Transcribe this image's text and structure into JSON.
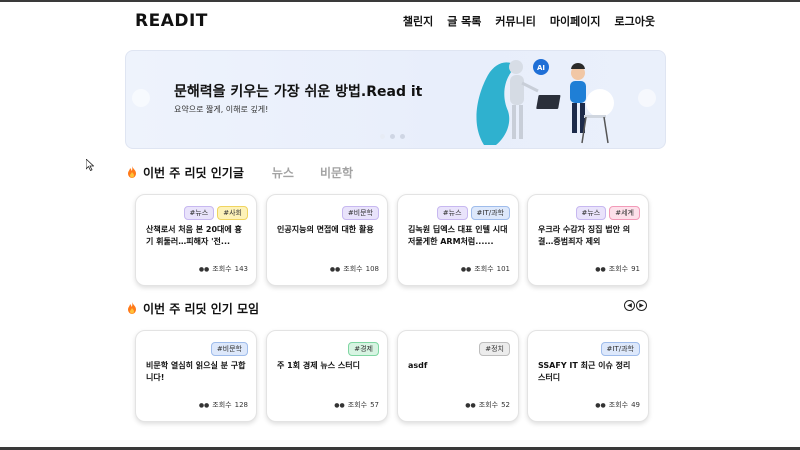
{
  "header": {
    "logo": "READIT",
    "nav": [
      "챌린지",
      "글 목록",
      "커뮤니티",
      "마이페이지",
      "로그아웃"
    ]
  },
  "banner": {
    "title": "문해력을 키우는 가장 쉬운 방법.Read it",
    "subtitle": "요약으로 짧게, 이해로 깊게!",
    "badge": "AI",
    "slides": 3,
    "active_slide": 1
  },
  "popular_posts": {
    "title": "이번 주 리딧 인기글",
    "tabs": [
      "뉴스",
      "비문학"
    ],
    "views_label": "조회수",
    "cards": [
      {
        "tags": [
          "#뉴스",
          "#사회"
        ],
        "title": "산책로서 처음 본 20대에 흉기 휘둘러…피해자 '전...",
        "views": "143"
      },
      {
        "tags": [
          "#비문학"
        ],
        "title": "인공지능의 면접에 대한 활용",
        "views": "108"
      },
      {
        "tags": [
          "#뉴스",
          "#IT/과학"
        ],
        "title": "김녹원 딥엑스 대표 인텔 시대 저물게한 ARM처럼......",
        "views": "101"
      },
      {
        "tags": [
          "#뉴스",
          "#세계"
        ],
        "title": "우크라 수감자 징집 법안 의결…중범죄자 제외",
        "views": "91"
      }
    ]
  },
  "popular_groups": {
    "title": "이번 주 리딧 인기 모임",
    "views_label": "조회수",
    "cards": [
      {
        "tags": [
          "#비문학"
        ],
        "title": "비문학 열심히 읽으실 분 구합니다!",
        "views": "128"
      },
      {
        "tags": [
          "#경제"
        ],
        "title": "주 1회 경제 뉴스 스터디",
        "views": "57"
      },
      {
        "tags": [
          "#정치"
        ],
        "title": "asdf",
        "views": "52"
      },
      {
        "tags": [
          "#IT/과학"
        ],
        "title": "SSAFY IT 최근 이슈 정리 스터디",
        "views": "49"
      }
    ]
  },
  "colors": {
    "tag_purple": "#e9e3fb",
    "tag_yellow": "#fdf2b8",
    "tag_blue": "#dde8fb",
    "tag_pink": "#fde0ea",
    "tag_green": "#d7f4e2",
    "tag_gray": "#ececec",
    "inactive_tab": "#a3a3a3"
  },
  "icons": [
    "fire-icon",
    "eye-icon",
    "prev-arrow-icon",
    "next-arrow-icon",
    "mouse-cursor-icon"
  ]
}
